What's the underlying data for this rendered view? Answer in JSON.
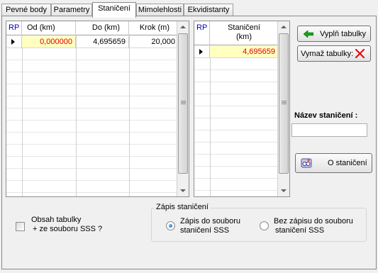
{
  "tabs": [
    {
      "label": "Pevné body"
    },
    {
      "label": "Parametry"
    },
    {
      "label": "Staničení",
      "active": true
    },
    {
      "label": "Mimolehlosti"
    },
    {
      "label": "Ekvidistanty"
    }
  ],
  "grid_ranges": {
    "columns": {
      "rp": "RP",
      "od": "Od (km)",
      "do": "Do (km)",
      "krok": "Krok  (m)"
    },
    "rows": [
      {
        "od": "0,000000",
        "do": "4,695659",
        "krok": "20,000"
      }
    ]
  },
  "grid_stations": {
    "columns": {
      "rp": "RP",
      "stan_line1": "Staničení",
      "stan_line2": "(km)"
    },
    "rows": [
      {
        "value": "4,695659"
      }
    ]
  },
  "buttons": {
    "fill_label": "Vyplň tabulky",
    "clear_label": "Vymaž tabulky:",
    "about_label": "O staničení"
  },
  "name_label": "Název staničení :",
  "name_value": "",
  "checkbox": {
    "line1": "Obsah tabulky",
    "line2": "+ ze souboru SSS  ?",
    "checked": false
  },
  "save_group": {
    "title": "Zápis staničení",
    "option1_line1": "Zápis  do souboru",
    "option1_line2": "staničení SSS",
    "option2_line1": "Bez zápisu  do souboru",
    "option2_line2": "staničení SSS",
    "selected": "option1"
  },
  "colors": {
    "selected_row_bg": "#ffffc0",
    "selected_value_text": "#e00000",
    "rp_header_text": "#0000c0",
    "fill_arrow": "#1aa01a",
    "clear_x": "#e00000"
  }
}
